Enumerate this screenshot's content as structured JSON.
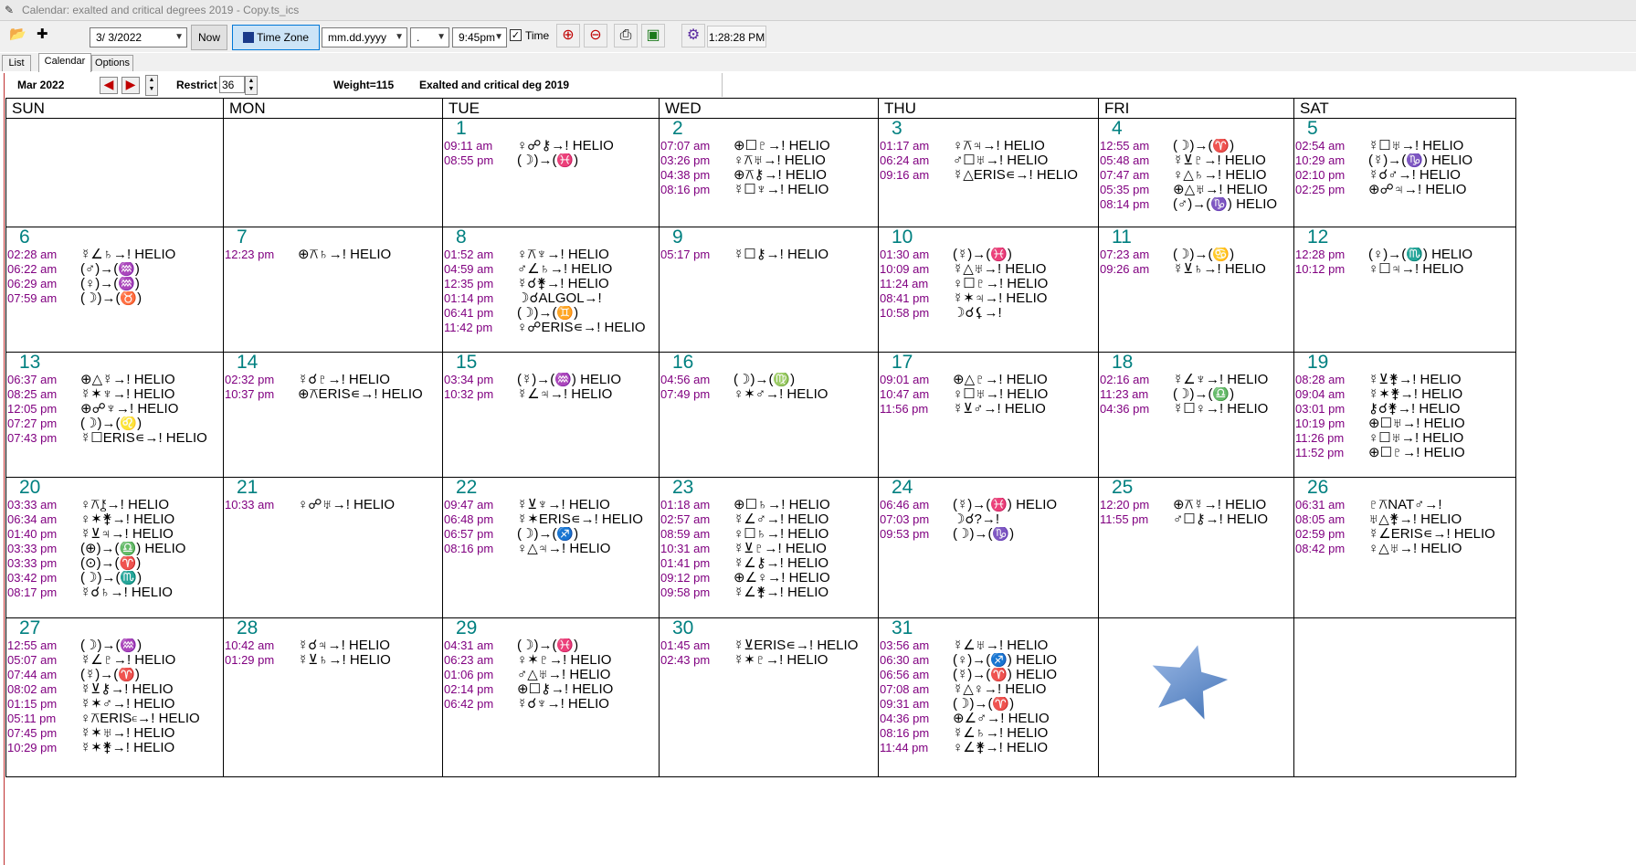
{
  "window": {
    "title": "Calendar: exalted and critical degrees 2019 - Copy.ts_ics"
  },
  "toolbar": {
    "date_value": "3/ 3/2022",
    "now_label": "Now",
    "timezone_label": "Time Zone",
    "date_format_value": "mm.dd.yyyy",
    "separator_value": ".",
    "time_value": "9:45pm",
    "time_checkbox_label": "Time",
    "clock": "1:28:28 PM"
  },
  "tabs": [
    {
      "label": "List"
    },
    {
      "label": "Calendar"
    },
    {
      "label": "Options"
    }
  ],
  "infobar": {
    "month": "Mar  2022",
    "restrict_label": "Restrict",
    "restrict_value": "36",
    "weight": "Weight=115",
    "name": "Exalted and critical deg 2019"
  },
  "calendar": {
    "weekdays": [
      "SUN",
      "MON",
      "TUE",
      "WED",
      "THU",
      "FRI",
      "SAT"
    ],
    "weeks": [
      [
        {
          "day": "",
          "events": []
        },
        {
          "day": "",
          "events": []
        },
        {
          "day": "1",
          "events": [
            [
              "09:11 am",
              "♀☍⚷→! HELIO"
            ],
            [
              "08:55 pm",
              "(☽)→(♓)"
            ]
          ]
        },
        {
          "day": "2",
          "events": [
            [
              "07:07 am",
              "⊕☐♇→! HELIO"
            ],
            [
              "03:26 pm",
              "♀⚻♅→! HELIO"
            ],
            [
              "04:38 pm",
              "⊕⚻⚷→! HELIO"
            ],
            [
              "08:16 pm",
              "☿☐♆→! HELIO"
            ]
          ]
        },
        {
          "day": "3",
          "events": [
            [
              "01:17 am",
              "♀⚻♃→! HELIO"
            ],
            [
              "06:24 am",
              "♂☐♅→! HELIO"
            ],
            [
              "09:16 am",
              "☿△ERIS∊→! HELIO"
            ]
          ]
        },
        {
          "day": "4",
          "events": [
            [
              "12:55 am",
              "(☽)→(♈)"
            ],
            [
              "05:48 am",
              "☿⊻♇→! HELIO"
            ],
            [
              "07:47 am",
              "♀△♄→! HELIO"
            ],
            [
              "05:35 pm",
              "⊕△♅→! HELIO"
            ],
            [
              "08:14 pm",
              "(♂)→(♑) HELIO"
            ]
          ]
        },
        {
          "day": "5",
          "events": [
            [
              "02:54 am",
              "☿☐♅→! HELIO"
            ],
            [
              "10:29 am",
              "(☿)→(♑) HELIO"
            ],
            [
              "02:10 pm",
              "☿☌♂→! HELIO"
            ],
            [
              "02:25 pm",
              "⊕☍♃→! HELIO"
            ]
          ]
        }
      ],
      [
        {
          "day": "6",
          "events": [
            [
              "02:28 am",
              "☿∠♄→! HELIO"
            ],
            [
              "06:22 am",
              "(♂)→(♒)"
            ],
            [
              "06:29 am",
              "(♀)→(♒)"
            ],
            [
              "07:59 am",
              "(☽)→(♉)"
            ]
          ]
        },
        {
          "day": "7",
          "events": [
            [
              "12:23 pm",
              "⊕⚻♄→! HELIO"
            ]
          ]
        },
        {
          "day": "8",
          "events": [
            [
              "01:52 am",
              "♀⚻♆→! HELIO"
            ],
            [
              "04:59 am",
              "♂∠♄→! HELIO"
            ],
            [
              "12:35 pm",
              "☿☌⚵→! HELIO"
            ],
            [
              "01:14 pm",
              "☽☌ALGOL→!"
            ],
            [
              "06:41 pm",
              "(☽)→(♊)"
            ],
            [
              "11:42 pm",
              "♀☍ERIS∊→! HELIO"
            ]
          ]
        },
        {
          "day": "9",
          "events": [
            [
              "05:17 pm",
              "☿☐⚷→! HELIO"
            ]
          ]
        },
        {
          "day": "10",
          "events": [
            [
              "01:30 am",
              "(☿)→(♓)"
            ],
            [
              "10:09 am",
              "☿△♅→! HELIO"
            ],
            [
              "11:24 am",
              "♀☐♇→! HELIO"
            ],
            [
              "08:41 pm",
              "☿✶♃→! HELIO"
            ],
            [
              "10:58 pm",
              "☽☌⚸→!"
            ]
          ]
        },
        {
          "day": "11",
          "events": [
            [
              "07:23 am",
              "(☽)→(♋)"
            ],
            [
              "09:26 am",
              "☿⊻♄→! HELIO"
            ]
          ]
        },
        {
          "day": "12",
          "events": [
            [
              "12:28 pm",
              "(♀)→(♏) HELIO"
            ],
            [
              "10:12 pm",
              "♀☐♃→! HELIO"
            ]
          ]
        }
      ],
      [
        {
          "day": "13",
          "events": [
            [
              "06:37 am",
              "⊕△☿→! HELIO"
            ],
            [
              "08:25 am",
              "☿✶♆→! HELIO"
            ],
            [
              "12:05 pm",
              "⊕☍♆→! HELIO"
            ],
            [
              "07:27 pm",
              "(☽)→(♌)"
            ],
            [
              "07:43 pm",
              "☿☐ERIS∊→! HELIO"
            ]
          ]
        },
        {
          "day": "14",
          "events": [
            [
              "02:32 pm",
              "☿☌♇→! HELIO"
            ],
            [
              "10:37 pm",
              "⊕⚻ERIS∊→! HELIO"
            ]
          ]
        },
        {
          "day": "15",
          "events": [
            [
              "03:34 pm",
              "(☿)→(♒) HELIO"
            ],
            [
              "10:32 pm",
              "☿∠♃→! HELIO"
            ]
          ]
        },
        {
          "day": "16",
          "events": [
            [
              "04:56 am",
              "(☽)→(♍)"
            ],
            [
              "07:49 pm",
              "♀✶♂→! HELIO"
            ]
          ]
        },
        {
          "day": "17",
          "events": [
            [
              "09:01 am",
              "⊕△♇→! HELIO"
            ],
            [
              "10:47 am",
              "♀☐♅→! HELIO"
            ],
            [
              "11:56 pm",
              "☿⊻♂→! HELIO"
            ]
          ]
        },
        {
          "day": "18",
          "events": [
            [
              "02:16 am",
              "☿∠♆→! HELIO"
            ],
            [
              "11:23 am",
              "(☽)→(♎)"
            ],
            [
              "04:36 pm",
              "☿☐♀→! HELIO"
            ]
          ]
        },
        {
          "day": "19",
          "events": [
            [
              "08:28 am",
              "☿⊻⚵→! HELIO"
            ],
            [
              "09:04 am",
              "☿✶⚵→! HELIO"
            ],
            [
              "03:01 pm",
              "⚷☌⚵→! HELIO"
            ],
            [
              "10:19 pm",
              "⊕☐♅→! HELIO"
            ],
            [
              "11:26 pm",
              "♀☐♅→! HELIO"
            ],
            [
              "11:52 pm",
              "⊕☐♇→! HELIO"
            ]
          ]
        }
      ],
      [
        {
          "day": "20",
          "events": [
            [
              "03:33 am",
              "♀⚻⚷→! HELIO"
            ],
            [
              "06:34 am",
              "♀✶⚵→! HELIO"
            ],
            [
              "01:40 pm",
              "☿⊻♃→! HELIO"
            ],
            [
              "03:33 pm",
              "(⊕)→(♎) HELIO"
            ],
            [
              "03:33 pm",
              "(⊙)→(♈)"
            ],
            [
              "03:42 pm",
              "(☽)→(♏)"
            ],
            [
              "08:17 pm",
              "☿☌♄→! HELIO"
            ]
          ]
        },
        {
          "day": "21",
          "events": [
            [
              "10:33 am",
              "♀☍♅→! HELIO"
            ]
          ]
        },
        {
          "day": "22",
          "events": [
            [
              "09:47 am",
              "☿⊻♆→! HELIO"
            ],
            [
              "06:48 pm",
              "☿✶ERIS∊→! HELIO"
            ],
            [
              "06:57 pm",
              "(☽)→(♐)"
            ],
            [
              "08:16 pm",
              "♀△♃→! HELIO"
            ]
          ]
        },
        {
          "day": "23",
          "events": [
            [
              "01:18 am",
              "⊕☐♄→! HELIO"
            ],
            [
              "02:57 am",
              "☿∠♂→! HELIO"
            ],
            [
              "08:59 am",
              "♀☐♄→! HELIO"
            ],
            [
              "10:31 am",
              "☿⊻♇→! HELIO"
            ],
            [
              "01:41 pm",
              "☿∠⚷→! HELIO"
            ],
            [
              "09:12 pm",
              "⊕∠♀→! HELIO"
            ],
            [
              "09:58 pm",
              "☿∠⚵→! HELIO"
            ]
          ]
        },
        {
          "day": "24",
          "events": [
            [
              "06:46 am",
              "(☿)→(♓) HELIO"
            ],
            [
              "07:03 pm",
              "☽☌?→!"
            ],
            [
              "09:53 pm",
              "(☽)→(♑)"
            ]
          ]
        },
        {
          "day": "25",
          "events": [
            [
              "12:20 pm",
              "⊕⚻☿→! HELIO"
            ],
            [
              "11:55 pm",
              "♂☐⚷→! HELIO"
            ]
          ]
        },
        {
          "day": "26",
          "events": [
            [
              "06:31 am",
              "♇⚻NAT♂→!"
            ],
            [
              "08:05 am",
              "♅△⚵→! HELIO"
            ],
            [
              "02:59 pm",
              "☿∠ERIS∊→! HELIO"
            ],
            [
              "08:42 pm",
              "♀△♅→! HELIO"
            ]
          ]
        }
      ],
      [
        {
          "day": "27",
          "events": [
            [
              "12:55 am",
              "(☽)→(♒)"
            ],
            [
              "05:07 am",
              "☿∠♇→! HELIO"
            ],
            [
              "07:44 am",
              "(☿)→(♈)"
            ],
            [
              "08:02 am",
              "☿⊻⚷→! HELIO"
            ],
            [
              "01:15 pm",
              "☿✶♂→! HELIO"
            ],
            [
              "05:11 pm",
              "♀⚻ERIS∊→! HELIO"
            ],
            [
              "07:45 pm",
              "☿✶♅→! HELIO"
            ],
            [
              "10:29 pm",
              "☿✶⚵→! HELIO"
            ]
          ]
        },
        {
          "day": "28",
          "events": [
            [
              "10:42 am",
              "☿☌♃→! HELIO"
            ],
            [
              "01:29 pm",
              "☿⊻♄→! HELIO"
            ]
          ]
        },
        {
          "day": "29",
          "events": [
            [
              "04:31 am",
              "(☽)→(♓)"
            ],
            [
              "06:23 am",
              "♀✶♇→! HELIO"
            ],
            [
              "01:06 pm",
              "♂△♅→! HELIO"
            ],
            [
              "02:14 pm",
              "⊕☐⚷→! HELIO"
            ],
            [
              "06:42 pm",
              "☿☌♆→! HELIO"
            ]
          ]
        },
        {
          "day": "30",
          "events": [
            [
              "01:45 am",
              "☿⊻ERIS∊→! HELIO"
            ],
            [
              "02:43 pm",
              "☿✶♇→! HELIO"
            ]
          ]
        },
        {
          "day": "31",
          "events": [
            [
              "03:56 am",
              "☿∠♅→! HELIO"
            ],
            [
              "06:30 am",
              "(♀)→(♐) HELIO"
            ],
            [
              "06:56 am",
              "(☿)→(♈) HELIO"
            ],
            [
              "07:08 am",
              "☿△♀→! HELIO"
            ],
            [
              "09:31 am",
              "(☽)→(♈)"
            ],
            [
              "04:36 pm",
              "⊕∠♂→! HELIO"
            ],
            [
              "08:16 pm",
              "☿∠♄→! HELIO"
            ],
            [
              "11:44 pm",
              "♀∠⚵→! HELIO"
            ]
          ]
        },
        {
          "day": "",
          "events": []
        },
        {
          "day": "",
          "events": []
        }
      ]
    ]
  },
  "colors": {
    "day_number": "#008080",
    "event_time": "#800080",
    "star": "#5b86c8"
  }
}
